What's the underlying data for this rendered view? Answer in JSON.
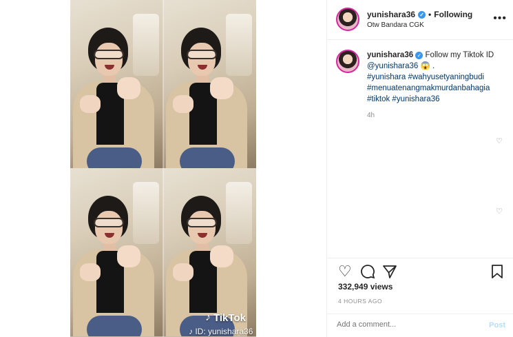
{
  "post": {
    "username": "yunishara36",
    "follow_status": "Following",
    "location": "Otw Bandara CGK",
    "caption_lines": [
      "Follow my Tiktok ID",
      "@yunishara36 😱 .",
      "#yunishara #wahyusetyaningbudi",
      "#menuatenangmakmurdanbahagia",
      "#tiktok #yunishara36"
    ],
    "relative_time": "4h",
    "views": "332,949 views",
    "posted_ago": "4 HOURS AGO",
    "comment_placeholder": "Add a comment...",
    "post_label": "Post"
  },
  "video": {
    "watermark_brand": "TikTok",
    "watermark_id": "ID: yunishara36"
  },
  "icons": {
    "verified": "verified-badge-icon",
    "more": "more-options-icon",
    "like": "heart-icon",
    "comment": "comment-icon",
    "share": "paper-plane-icon",
    "save": "bookmark-icon"
  },
  "colors": {
    "verified_blue": "#3897f0",
    "post_button": "#b2dffc",
    "tag_link": "#00376b",
    "muted_text": "#8e8e8e"
  }
}
